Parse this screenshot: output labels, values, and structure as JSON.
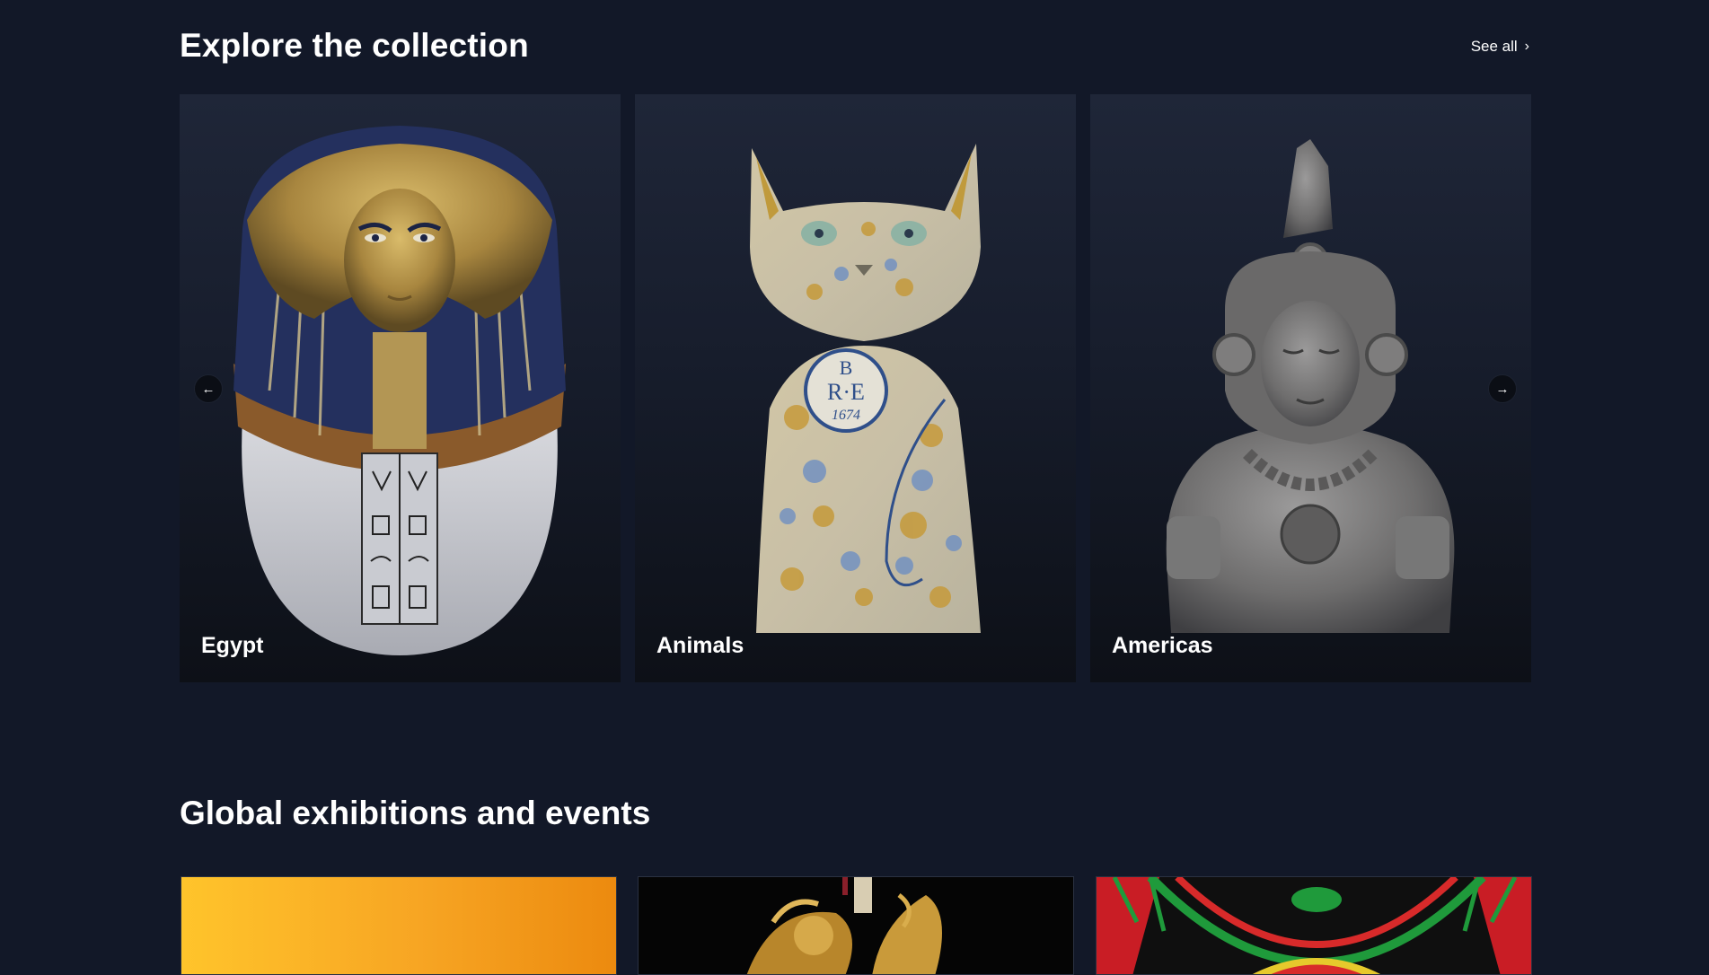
{
  "collection": {
    "title": "Explore the collection",
    "see_all": "See all",
    "cards": [
      {
        "label": "Egypt"
      },
      {
        "label": "Animals"
      },
      {
        "label": "Americas"
      }
    ],
    "prev_icon": "arrow-left-icon",
    "next_icon": "arrow-right-icon"
  },
  "exhibitions": {
    "title": "Global exhibitions and events"
  },
  "colors": {
    "page_background": "#121828",
    "text": "#ffffff",
    "exhibition_card_1": "#f7a523"
  }
}
